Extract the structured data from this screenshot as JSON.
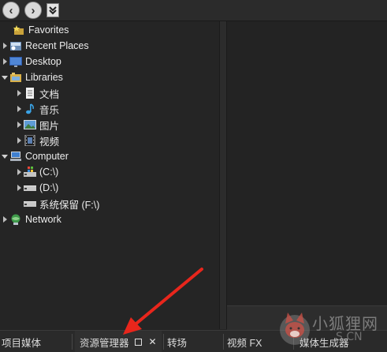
{
  "toolbar": {
    "back_glyph": "‹",
    "forward_glyph": "›",
    "dropdown_glyph": "⌄"
  },
  "tree": [
    {
      "label": "Favorites",
      "icon": "star-folder-icon",
      "indent": 1,
      "arrow": "none"
    },
    {
      "label": "Recent Places",
      "icon": "recent-places-icon",
      "indent": 0,
      "arrow": "right"
    },
    {
      "label": "Desktop",
      "icon": "desktop-icon",
      "indent": 0,
      "arrow": "right"
    },
    {
      "label": "Libraries",
      "icon": "libraries-icon",
      "indent": 0,
      "arrow": "down"
    },
    {
      "label": "文档",
      "icon": "document-icon",
      "indent": 1,
      "arrow": "right"
    },
    {
      "label": "音乐",
      "icon": "music-icon",
      "indent": 1,
      "arrow": "right"
    },
    {
      "label": "图片",
      "icon": "picture-icon",
      "indent": 1,
      "arrow": "right"
    },
    {
      "label": "视频",
      "icon": "video-icon",
      "indent": 1,
      "arrow": "right"
    },
    {
      "label": "Computer",
      "icon": "computer-icon",
      "indent": 0,
      "arrow": "down"
    },
    {
      "label": "(C:\\)",
      "icon": "system-drive-icon",
      "indent": 1,
      "arrow": "right"
    },
    {
      "label": "(D:\\)",
      "icon": "drive-icon",
      "indent": 1,
      "arrow": "right"
    },
    {
      "label": "系统保留 (F:\\)",
      "icon": "drive-icon",
      "indent": 1,
      "arrow": "none"
    },
    {
      "label": "Network",
      "icon": "network-icon",
      "indent": 0,
      "arrow": "right"
    }
  ],
  "tabs": [
    {
      "label": "项目媒体"
    },
    {
      "label": "资源管理器",
      "active": true
    },
    {
      "label": "转场"
    },
    {
      "label": "视频 FX"
    },
    {
      "label": "媒体生成器"
    }
  ],
  "watermark": {
    "text": "小狐狸网",
    "sub": "S.CN"
  },
  "colors": {
    "background": "#232323",
    "annotation_arrow": "#e8261c",
    "text": "#ececec"
  }
}
